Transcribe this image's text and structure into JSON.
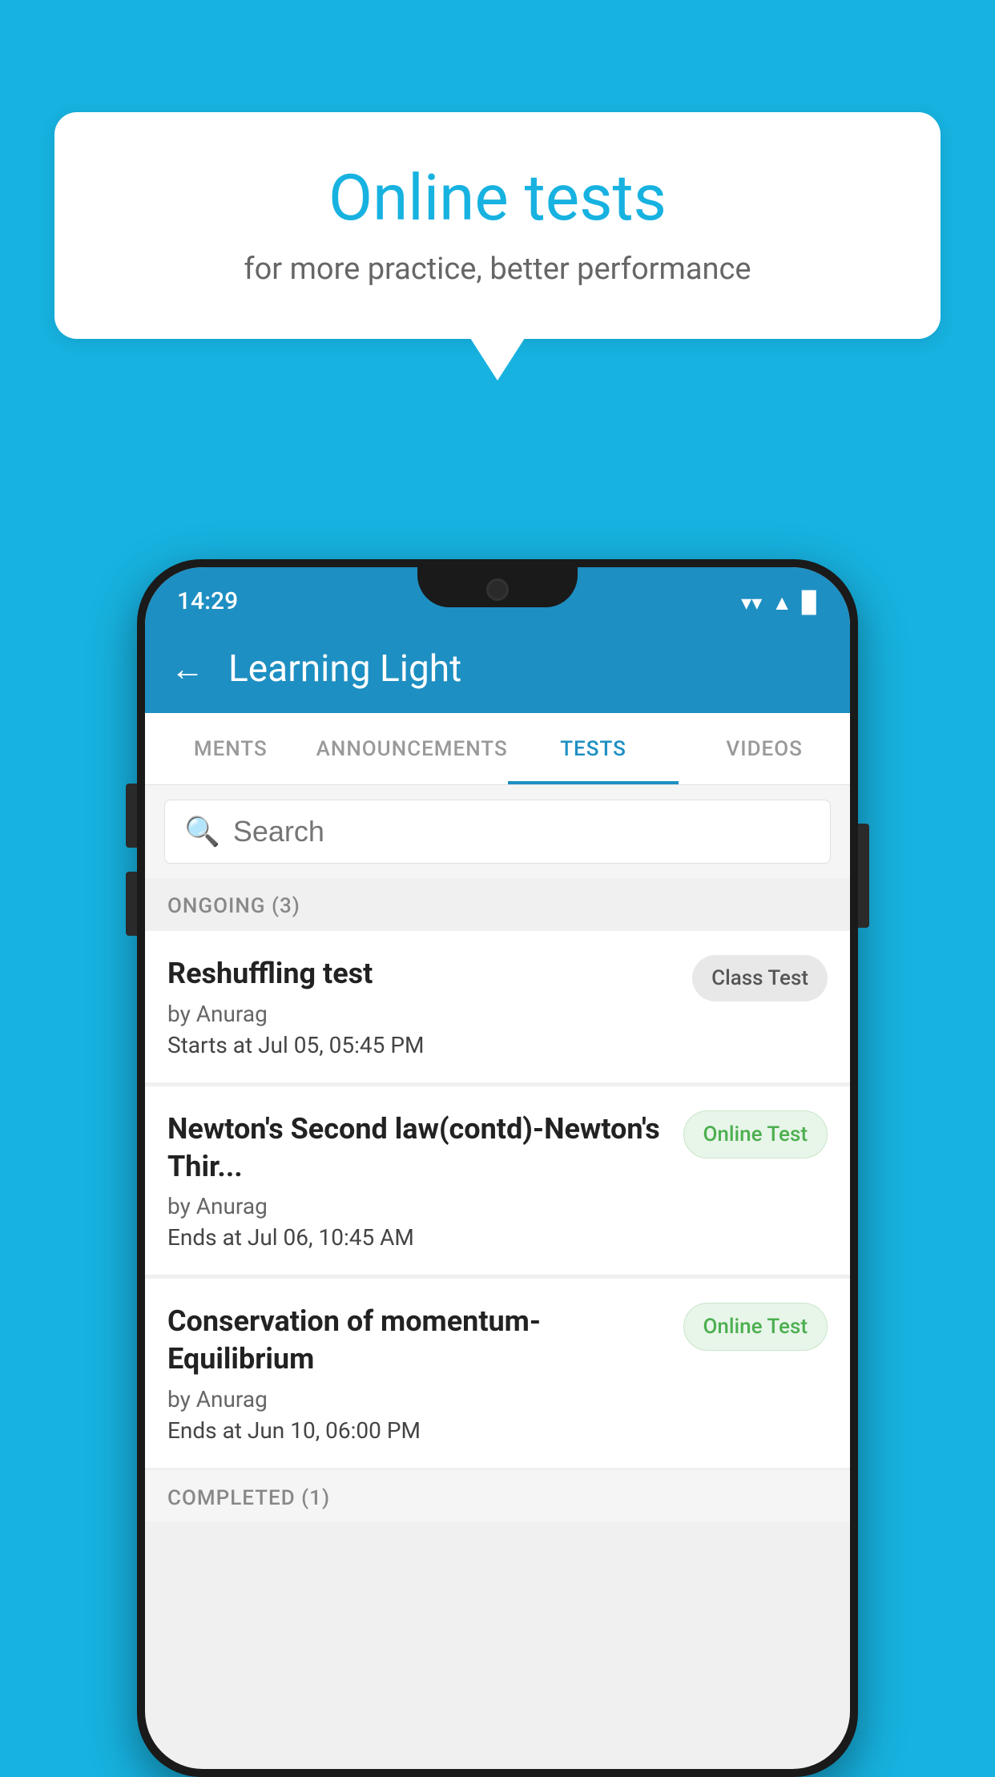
{
  "background_color": "#17b2e0",
  "bubble": {
    "title": "Online tests",
    "subtitle": "for more practice, better performance"
  },
  "status_bar": {
    "time": "14:29"
  },
  "app_bar": {
    "title": "Learning Light",
    "back_label": "←"
  },
  "tabs": [
    {
      "label": "MENTS",
      "active": false
    },
    {
      "label": "ANNOUNCEMENTS",
      "active": false
    },
    {
      "label": "TESTS",
      "active": true
    },
    {
      "label": "VIDEOS",
      "active": false
    }
  ],
  "search": {
    "placeholder": "Search"
  },
  "sections": [
    {
      "header": "ONGOING (3)",
      "items": [
        {
          "name": "Reshuffling test",
          "author": "by Anurag",
          "date_label": "Starts at",
          "date_value": "Jul 05, 05:45 PM",
          "badge": "Class Test",
          "badge_type": "class"
        },
        {
          "name": "Newton's Second law(contd)-Newton's Thir...",
          "author": "by Anurag",
          "date_label": "Ends at",
          "date_value": "Jul 06, 10:45 AM",
          "badge": "Online Test",
          "badge_type": "online"
        },
        {
          "name": "Conservation of momentum-Equilibrium",
          "author": "by Anurag",
          "date_label": "Ends at",
          "date_value": "Jun 10, 06:00 PM",
          "badge": "Online Test",
          "badge_type": "online"
        }
      ]
    },
    {
      "header": "COMPLETED (1)",
      "items": []
    }
  ]
}
